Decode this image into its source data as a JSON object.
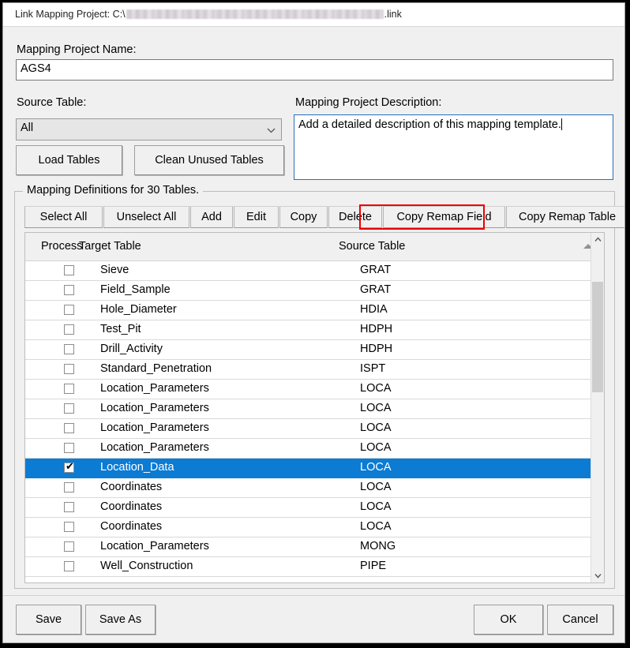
{
  "window": {
    "title_prefix": "Link Mapping Project: C:\\",
    "title_suffix": ".link",
    "path_redacted": true
  },
  "form": {
    "project_name_label": "Mapping Project Name:",
    "project_name_value": "AGS4",
    "project_name_placeholder": "",
    "source_table_label": "Source Table:",
    "source_table_value": "All",
    "source_table_options": [
      "All"
    ],
    "description_label": "Mapping Project Description:",
    "description_value": "Add a detailed description of this mapping template.",
    "description_placeholder": "",
    "load_tables_label": "Load Tables",
    "clean_unused_tables_label": "Clean Unused Tables"
  },
  "group": {
    "legend": "Mapping Definitions for 30 Tables.",
    "toolbar": [
      {
        "label": "Select All",
        "name": "select-all-button",
        "highlighted": false
      },
      {
        "label": "Unselect All",
        "name": "unselect-all-button",
        "highlighted": false
      },
      {
        "label": "Add",
        "name": "add-button",
        "highlighted": false
      },
      {
        "label": "Edit",
        "name": "edit-button",
        "highlighted": false
      },
      {
        "label": "Copy",
        "name": "copy-button",
        "highlighted": false
      },
      {
        "label": "Delete",
        "name": "delete-button",
        "highlighted": false
      },
      {
        "label": "Copy Remap Field",
        "name": "copy-remap-field-button",
        "highlighted": true
      },
      {
        "label": "Copy Remap Table",
        "name": "copy-remap-table-button",
        "highlighted": false
      }
    ]
  },
  "list": {
    "columns": [
      "Process",
      "Target Table",
      "Source Table"
    ],
    "sort_column": "Source Table",
    "sort_direction": "ascending",
    "rows": [
      {
        "checked": false,
        "target": "Sieve",
        "source": "GRAT",
        "selected": false
      },
      {
        "checked": false,
        "target": "Field_Sample",
        "source": "GRAT",
        "selected": false
      },
      {
        "checked": false,
        "target": "Hole_Diameter",
        "source": "HDIA",
        "selected": false
      },
      {
        "checked": false,
        "target": "Test_Pit",
        "source": "HDPH",
        "selected": false
      },
      {
        "checked": false,
        "target": "Drill_Activity",
        "source": "HDPH",
        "selected": false
      },
      {
        "checked": false,
        "target": "Standard_Penetration",
        "source": "ISPT",
        "selected": false
      },
      {
        "checked": false,
        "target": "Location_Parameters",
        "source": "LOCA",
        "selected": false
      },
      {
        "checked": false,
        "target": "Location_Parameters",
        "source": "LOCA",
        "selected": false
      },
      {
        "checked": false,
        "target": "Location_Parameters",
        "source": "LOCA",
        "selected": false
      },
      {
        "checked": false,
        "target": "Location_Parameters",
        "source": "LOCA",
        "selected": false
      },
      {
        "checked": true,
        "target": "Location_Data",
        "source": "LOCA",
        "selected": true
      },
      {
        "checked": false,
        "target": "Coordinates",
        "source": "LOCA",
        "selected": false
      },
      {
        "checked": false,
        "target": "Coordinates",
        "source": "LOCA",
        "selected": false
      },
      {
        "checked": false,
        "target": "Coordinates",
        "source": "LOCA",
        "selected": false
      },
      {
        "checked": false,
        "target": "Location_Parameters",
        "source": "MONG",
        "selected": false
      },
      {
        "checked": false,
        "target": "Well_Construction",
        "source": "PIPE",
        "selected": false
      }
    ],
    "checkbox_checked_glyph": "✔",
    "scrollbar": {
      "up_arrow_glyph": "⌃",
      "down_arrow_glyph": "⌄"
    }
  },
  "footer": {
    "save_label": "Save",
    "save_as_label": "Save As",
    "ok_label": "OK",
    "cancel_label": "Cancel"
  },
  "colors": {
    "selection_blue": "#0b7bd4",
    "annotation_red": "#ee0000",
    "focus_border_blue": "#2a6ebb",
    "window_background": "#f0f0f0"
  }
}
